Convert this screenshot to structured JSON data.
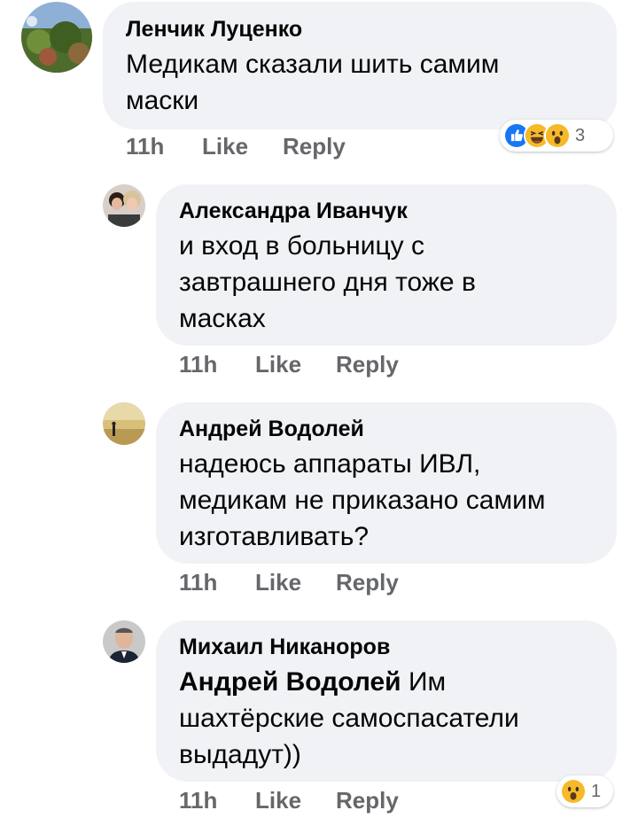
{
  "comments": [
    {
      "author": "Ленчик Луценко",
      "text_lines": [
        "Медикам сказали шить самим",
        "маски"
      ],
      "time": "11h",
      "like": "Like",
      "reply": "Reply",
      "reactions": {
        "icons": [
          "like-icon",
          "haha-icon",
          "wow-icon"
        ],
        "count": "3"
      }
    },
    {
      "author": "Александра Иванчук",
      "text_lines": [
        "и вход в больницу с",
        "завтрашнего дня тоже в",
        "масках"
      ],
      "time": "11h",
      "like": "Like",
      "reply": "Reply"
    },
    {
      "author": "Андрей Водолей",
      "text_lines": [
        "надеюсь аппараты ИВЛ,",
        "медикам не приказано самим",
        "изготавливать?"
      ],
      "time": "11h",
      "like": "Like",
      "reply": "Reply"
    },
    {
      "author": "Михаил Никаноров",
      "mention": "Андрей Водолей",
      "text_after_mention": " Им",
      "text_lines": [
        "шахтёрские самоспасатели",
        "выдадут))"
      ],
      "time": "11h",
      "like": "Like",
      "reply": "Reply",
      "reactions": {
        "icons": [
          "wow-icon"
        ],
        "count": "1"
      }
    }
  ],
  "colors": {
    "bubble": "#f0f2f5",
    "meta_text": "#65676b",
    "like_blue": "#1877f2",
    "emoji_yellow": "#f7b928"
  }
}
